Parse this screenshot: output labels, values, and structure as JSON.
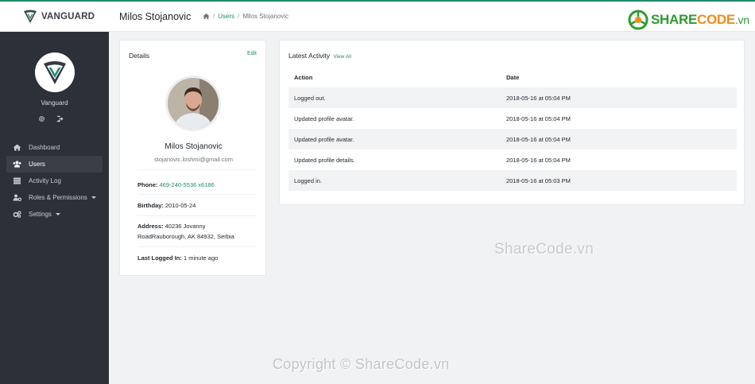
{
  "brand": {
    "name": "VANGUARD"
  },
  "header": {
    "title": "Milos Stojanovic",
    "breadcrumb": [
      {
        "label": "Users"
      },
      {
        "label": "Milos Stojanovic"
      }
    ]
  },
  "sharecode_logo": {
    "text_share": "SHARE",
    "text_code": "CODE",
    "text_vn": ".vn"
  },
  "sidebar": {
    "name": "Vanguard",
    "items": [
      {
        "label": "Dashboard",
        "icon": "home-icon"
      },
      {
        "label": "Users",
        "icon": "users-icon",
        "active": true
      },
      {
        "label": "Activity Log",
        "icon": "server-icon"
      },
      {
        "label": "Roles & Permissions",
        "icon": "user-cog-icon",
        "dropdown": true
      },
      {
        "label": "Settings",
        "icon": "cogs-icon",
        "dropdown": true
      }
    ]
  },
  "details": {
    "title": "Details",
    "edit_label": "Edit",
    "name": "Milos Stojanovic",
    "email": "stojanovic.loshmi@gmail.com",
    "phone_label": "Phone:",
    "phone": "469-240-5536 x6186",
    "birthday_label": "Birthday:",
    "birthday": "2010-05-24",
    "address_label": "Address:",
    "address_line1": "40236 Jovanny",
    "address_line2": "RoadRauborough, AK 84932, Serbia",
    "last_logged_label": "Last Logged In:",
    "last_logged": "1 minute ago"
  },
  "activity": {
    "title": "Latest Activity",
    "view_all": "View All",
    "columns": [
      "Action",
      "Date"
    ],
    "rows": [
      {
        "action": "Logged out.",
        "date": "2018-05-16 at 05:04 PM"
      },
      {
        "action": "Updated profile avatar.",
        "date": "2018-05-16 at 05:04 PM"
      },
      {
        "action": "Updated profile avatar.",
        "date": "2018-05-16 at 05:04 PM"
      },
      {
        "action": "Updated profile details.",
        "date": "2018-05-16 at 05:04 PM"
      },
      {
        "action": "Logged in.",
        "date": "2018-05-16 at 05:03 PM"
      }
    ]
  },
  "watermarks": {
    "middle": "ShareCode.vn",
    "bottom": "Copyright © ShareCode.vn"
  },
  "colors": {
    "accent": "#1f8b6c",
    "sidebar": "#2c3038",
    "background": "#f1f2f4"
  }
}
